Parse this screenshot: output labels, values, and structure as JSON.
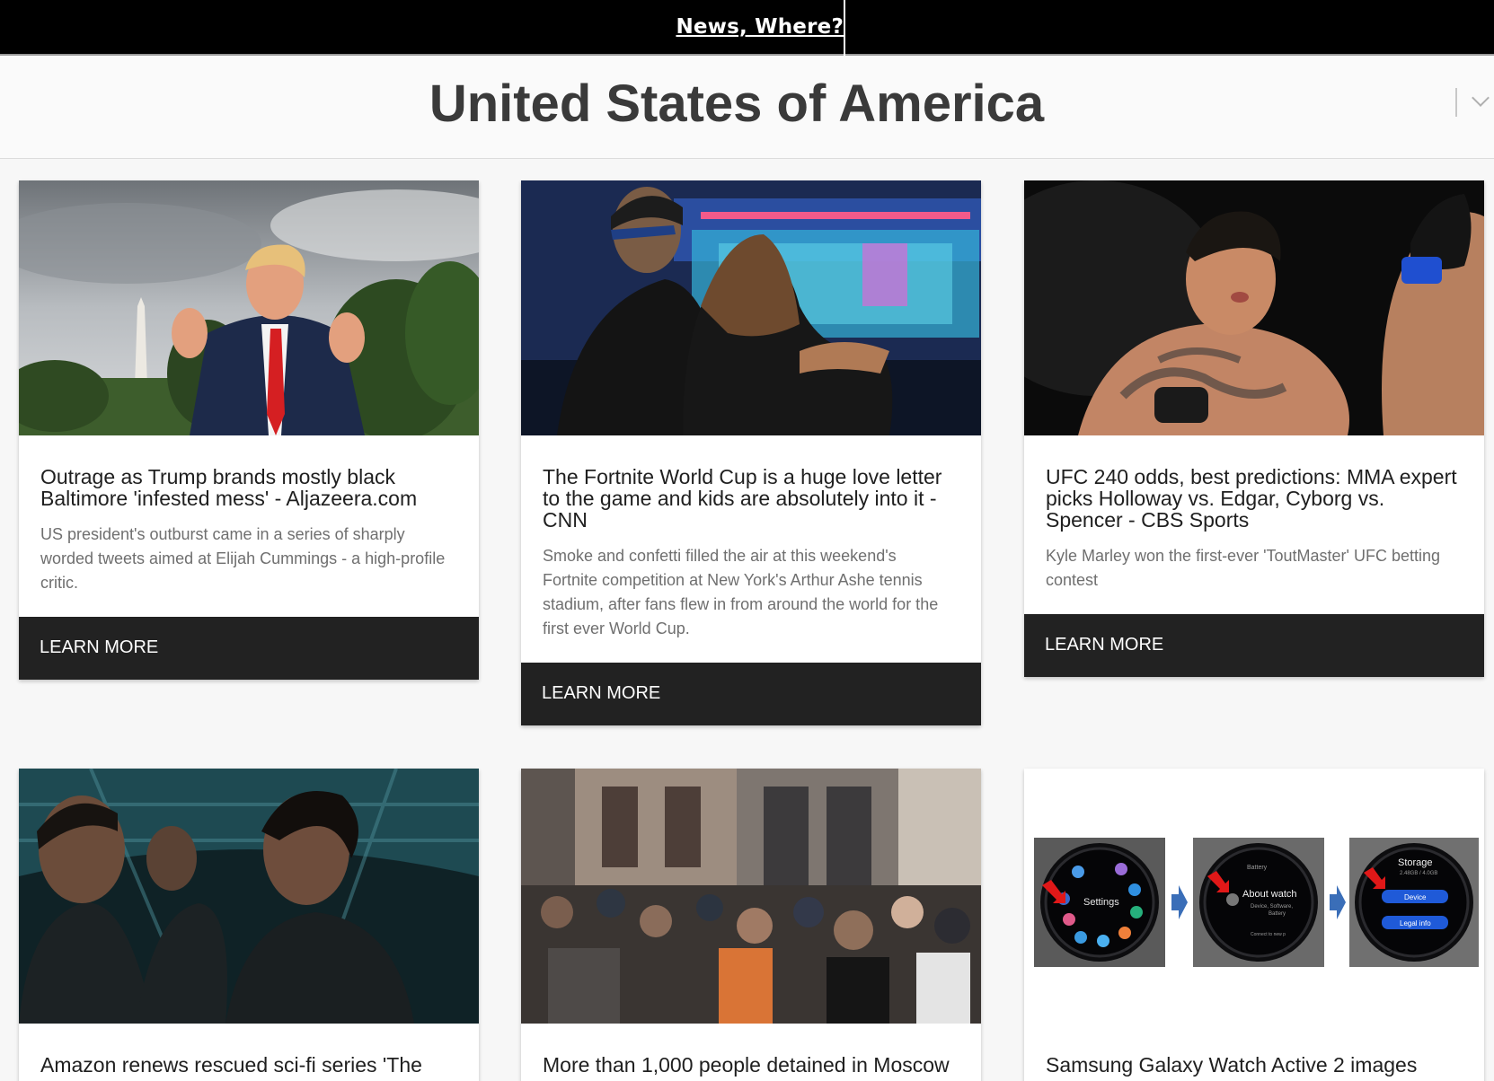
{
  "header": {
    "brand": "News, Where?"
  },
  "country": {
    "title": "United States of America"
  },
  "learn_more_label": "LEARN MORE",
  "articles": [
    {
      "title": "Outrage as Trump brands mostly black Baltimore 'infested mess' - Aljazeera.com",
      "description": "US president's outburst came in a series of sharply worded tweets aimed at Elijah Cummings - a high-profile critic."
    },
    {
      "title": "The Fortnite World Cup is a huge love letter to the game and kids are absolutely into it - CNN",
      "description": "Smoke and confetti filled the air at this weekend's Fortnite competition at New York's Arthur Ashe tennis stadium, after fans flew in from around the world for the first ever World Cup."
    },
    {
      "title": "UFC 240 odds, best predictions: MMA expert picks Holloway vs. Edgar, Cyborg vs. Spencer - CBS Sports",
      "description": "Kyle Marley won the first-ever 'ToutMaster' UFC betting contest"
    },
    {
      "title": "Amazon renews rescued sci-fi series 'The"
    },
    {
      "title": "More than 1,000 people detained in Moscow"
    },
    {
      "title": "Samsung Galaxy Watch Active 2 images",
      "image_labels": {
        "settings": "Settings",
        "battery": "Battery",
        "about_watch": "About watch",
        "about_sub1": "Device, Software,",
        "about_sub2": "Battery",
        "connect": "Connect to new p",
        "storage": "Storage",
        "storage_value": "2.48GB / 4.0GB",
        "device": "Device",
        "legal": "Legal info"
      }
    }
  ]
}
